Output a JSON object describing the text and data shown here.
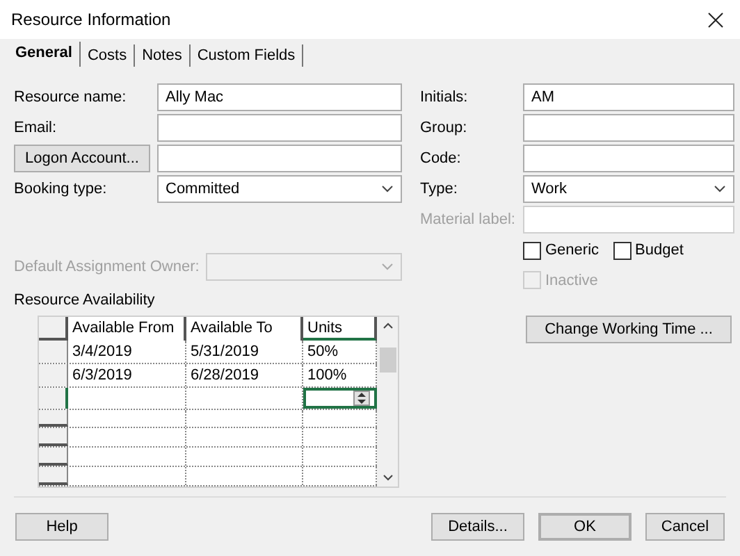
{
  "window": {
    "title": "Resource Information"
  },
  "tabs": [
    {
      "label": "General",
      "selected": true
    },
    {
      "label": "Costs",
      "selected": false
    },
    {
      "label": "Notes",
      "selected": false
    },
    {
      "label": "Custom Fields",
      "selected": false
    }
  ],
  "left_fields": [
    {
      "kind": "text",
      "label": "Resource name:",
      "value": "Ally Mac"
    },
    {
      "kind": "text",
      "label": "Email:"
    },
    {
      "kind": "button",
      "label": "Logon Account..."
    },
    {
      "kind": "dropdown",
      "label": "Booking type:",
      "value": "Committed"
    }
  ],
  "default_owner": {
    "label": "Default Assignment Owner:",
    "disabled": true
  },
  "right_fields": [
    {
      "kind": "text",
      "label": "Initials:",
      "value": "AM",
      "disabled": false
    },
    {
      "kind": "text",
      "label": "Group:",
      "disabled": false
    },
    {
      "kind": "text",
      "label": "Code:",
      "disabled": false
    },
    {
      "kind": "dropdown",
      "label": "Type:",
      "value": "Work",
      "disabled": false
    },
    {
      "kind": "text",
      "label": "Material label:",
      "disabled": true
    }
  ],
  "checkboxes": [
    {
      "label": "Generic",
      "checked": false,
      "disabled": false
    },
    {
      "label": "Budget",
      "checked": false,
      "disabled": false
    },
    {
      "label": "Inactive",
      "checked": false,
      "disabled": true
    }
  ],
  "change_working_time_button": "Change Working Time ...",
  "availability": {
    "title": "Resource Availability",
    "columns": [
      "Available From",
      "Available To",
      "Units"
    ],
    "rows": [
      {
        "from": "3/4/2019",
        "to": "5/31/2019",
        "units": "50%"
      },
      {
        "from": "6/3/2019",
        "to": "6/28/2019",
        "units": "100%"
      }
    ],
    "editing_row": {
      "selected": true
    }
  },
  "buttons": {
    "help": "Help",
    "details": "Details...",
    "ok": "OK",
    "cancel": "Cancel"
  }
}
